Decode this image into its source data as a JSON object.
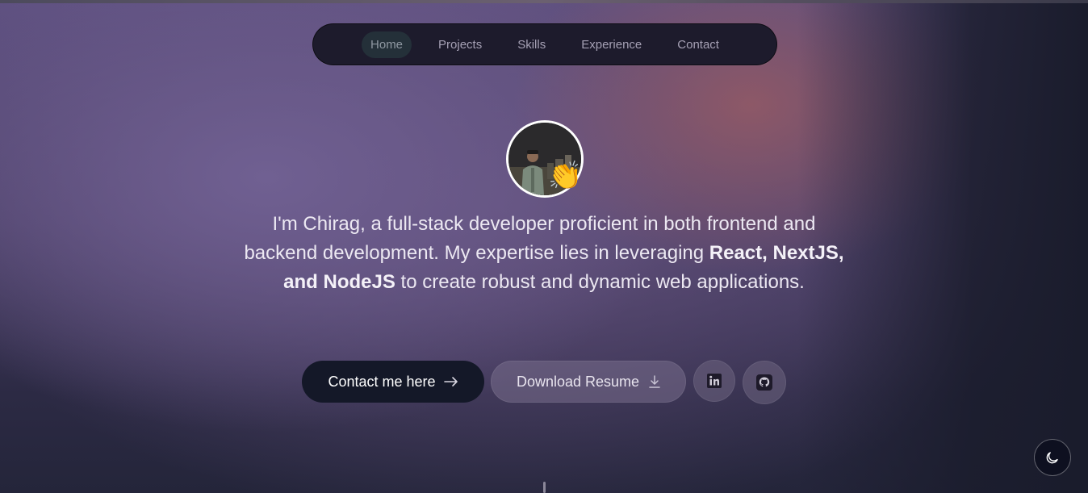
{
  "nav": {
    "items": [
      {
        "label": "Home",
        "active": true
      },
      {
        "label": "Projects",
        "active": false
      },
      {
        "label": "Skills",
        "active": false
      },
      {
        "label": "Experience",
        "active": false
      },
      {
        "label": "Contact",
        "active": false
      }
    ]
  },
  "hero": {
    "avatar_icon": "profile-photo",
    "wave_emoji": "👏",
    "intro_part1": "I'm Chirag, a full-stack developer proficient in both frontend and backend development. My expertise lies in leveraging ",
    "intro_bold": "React, NextJS, and NodeJS",
    "intro_part2": " to create robust and dynamic web applications."
  },
  "actions": {
    "contact_label": "Contact me here",
    "contact_icon": "arrow-right-icon",
    "resume_label": "Download Resume",
    "resume_icon": "download-icon",
    "linkedin_icon": "linkedin-icon",
    "github_icon": "github-icon"
  },
  "theme_toggle": {
    "icon": "moon-icon"
  },
  "colors": {
    "nav_bg": "#1d1b2c",
    "active_pill": "#243039",
    "contact_bg": "#141828",
    "text": "#ece8f2"
  }
}
